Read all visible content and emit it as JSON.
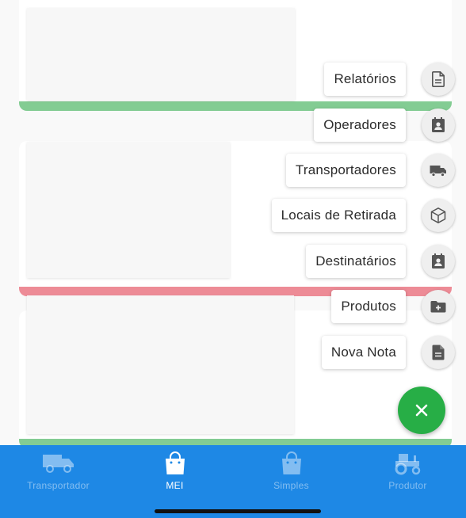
{
  "colors": {
    "accent_green": "#27ae46",
    "accent_red": "#e0374b",
    "nav_blue": "#1e88e5",
    "mini_fab_bg": "#efefef",
    "icon_gray": "#555555"
  },
  "cards": [
    {
      "status_color": "#2aa845"
    },
    {
      "status_color": "#e0374b"
    },
    {
      "status_color": "#2aa845"
    }
  ],
  "fab_menu": {
    "items": [
      {
        "label": "Relatórios",
        "icon": "report-document-icon"
      },
      {
        "label": "Operadores",
        "icon": "contact-badge-icon"
      },
      {
        "label": "Transportadores",
        "icon": "truck-icon"
      },
      {
        "label": "Locais de Retirada",
        "icon": "cube-icon"
      },
      {
        "label": "Destinatários",
        "icon": "contact-badge-icon"
      },
      {
        "label": "Produtos",
        "icon": "folder-plus-icon"
      },
      {
        "label": "Nova Nota",
        "icon": "document-icon"
      }
    ],
    "close_icon": "close-icon"
  },
  "bottom_nav": {
    "tabs": [
      {
        "label": "Transportador",
        "icon": "truck-icon",
        "active": false
      },
      {
        "label": "MEI",
        "icon": "shopping-bag-icon",
        "active": true
      },
      {
        "label": "Simples",
        "icon": "shopping-bag-icon",
        "active": false
      },
      {
        "label": "Produtor",
        "icon": "tractor-icon",
        "active": false
      }
    ]
  }
}
